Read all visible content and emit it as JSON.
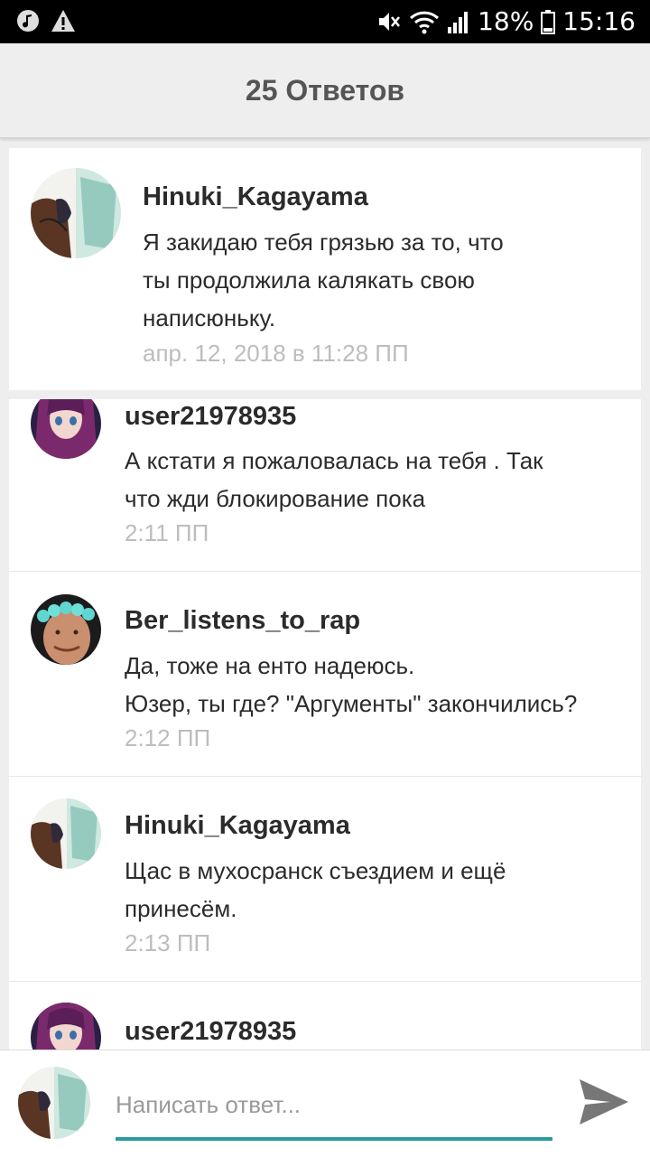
{
  "status_bar": {
    "battery": "18%",
    "time": "15:16",
    "icons": [
      "music-icon",
      "warning-icon",
      "mute-icon",
      "wifi-icon",
      "signal-icon",
      "battery-icon"
    ]
  },
  "header": {
    "title": "25 Ответов"
  },
  "main_comment": {
    "username": "Hinuki_Kagayama",
    "lines": [
      "Я закидаю тебя грязью за то, что",
      "ты продолжила калякать свою",
      "написюньку."
    ],
    "time": "апр. 12, 2018 в 11:28 ПП"
  },
  "replies": [
    {
      "username": "user21978935",
      "lines": [
        "А кстати я пожаловалась на тебя . Так",
        "что жди блокирование пока"
      ],
      "time": "2:11 ПП",
      "avatar": "anime-girl"
    },
    {
      "username": "Ber_listens_to_rap",
      "lines": [
        "Да, тоже на енто надеюсь.",
        "Юзер, ты где? \"Аргументы\" закончились?"
      ],
      "time": "2:12 ПП",
      "avatar": "man-flower-crown"
    },
    {
      "username": "Hinuki_Kagayama",
      "lines": [
        "Щас в мухосранск съездием и ещё",
        "принесём."
      ],
      "time": "2:13 ПП",
      "avatar": "drawing"
    },
    {
      "username": "user21978935",
      "lines": [],
      "time": "",
      "avatar": "anime-girl"
    }
  ],
  "composer": {
    "placeholder": "Написать ответ...",
    "accent": "#2a9aa0"
  }
}
